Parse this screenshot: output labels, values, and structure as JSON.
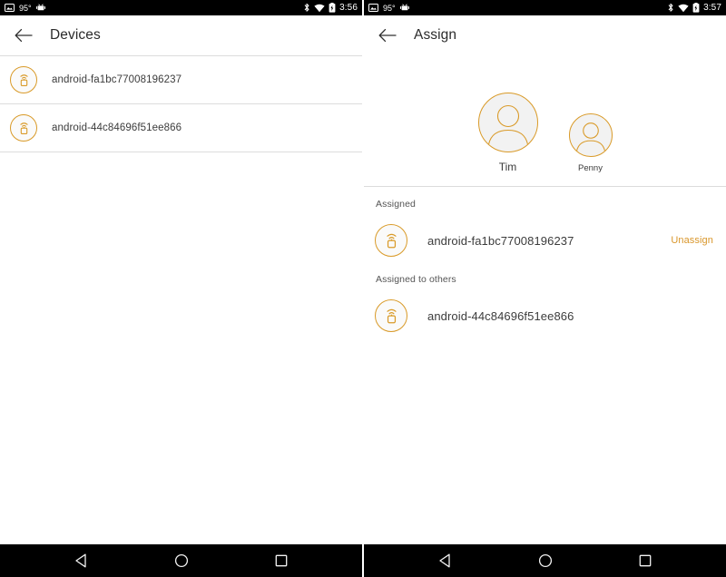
{
  "accent_color": "#d99a28",
  "unassign_color": "#d9962a",
  "screens": [
    {
      "id": "devices",
      "status_bar": {
        "screenshot_icon": "screenshot-icon",
        "temperature": "95°",
        "android_icon": "android-icon",
        "bluetooth_icon": "bluetooth-icon",
        "wifi_icon": "wifi-icon",
        "battery_icon": "battery-charging-icon",
        "time": "3:56"
      },
      "app_bar": {
        "back_icon": "back-arrow-icon",
        "title": "Devices"
      },
      "devices": [
        {
          "icon": "cast-device-icon",
          "name": "android-fa1bc77008196237"
        },
        {
          "icon": "cast-device-icon",
          "name": "android-44c84696f51ee866"
        }
      ],
      "nav_bar": {
        "back": "nav-back-triangle-icon",
        "home": "nav-home-circle-icon",
        "recents": "nav-recents-square-icon"
      }
    },
    {
      "id": "assign",
      "status_bar": {
        "screenshot_icon": "screenshot-icon",
        "temperature": "95°",
        "android_icon": "android-icon",
        "bluetooth_icon": "bluetooth-icon",
        "wifi_icon": "wifi-icon",
        "battery_icon": "battery-charging-icon",
        "time": "3:57"
      },
      "app_bar": {
        "back_icon": "back-arrow-icon",
        "title": "Assign"
      },
      "people": [
        {
          "name": "Tim",
          "selected": true,
          "avatar_icon": "person-avatar-icon"
        },
        {
          "name": "Penny",
          "selected": false,
          "avatar_icon": "person-avatar-icon"
        }
      ],
      "sections": [
        {
          "heading": "Assigned",
          "rows": [
            {
              "icon": "cast-device-icon",
              "name": "android-fa1bc77008196237",
              "action_label": "Unassign"
            }
          ]
        },
        {
          "heading": "Assigned to others",
          "rows": [
            {
              "icon": "cast-device-icon",
              "name": "android-44c84696f51ee866",
              "action_label": ""
            }
          ]
        }
      ],
      "nav_bar": {
        "back": "nav-back-triangle-icon",
        "home": "nav-home-circle-icon",
        "recents": "nav-recents-square-icon"
      }
    }
  ]
}
